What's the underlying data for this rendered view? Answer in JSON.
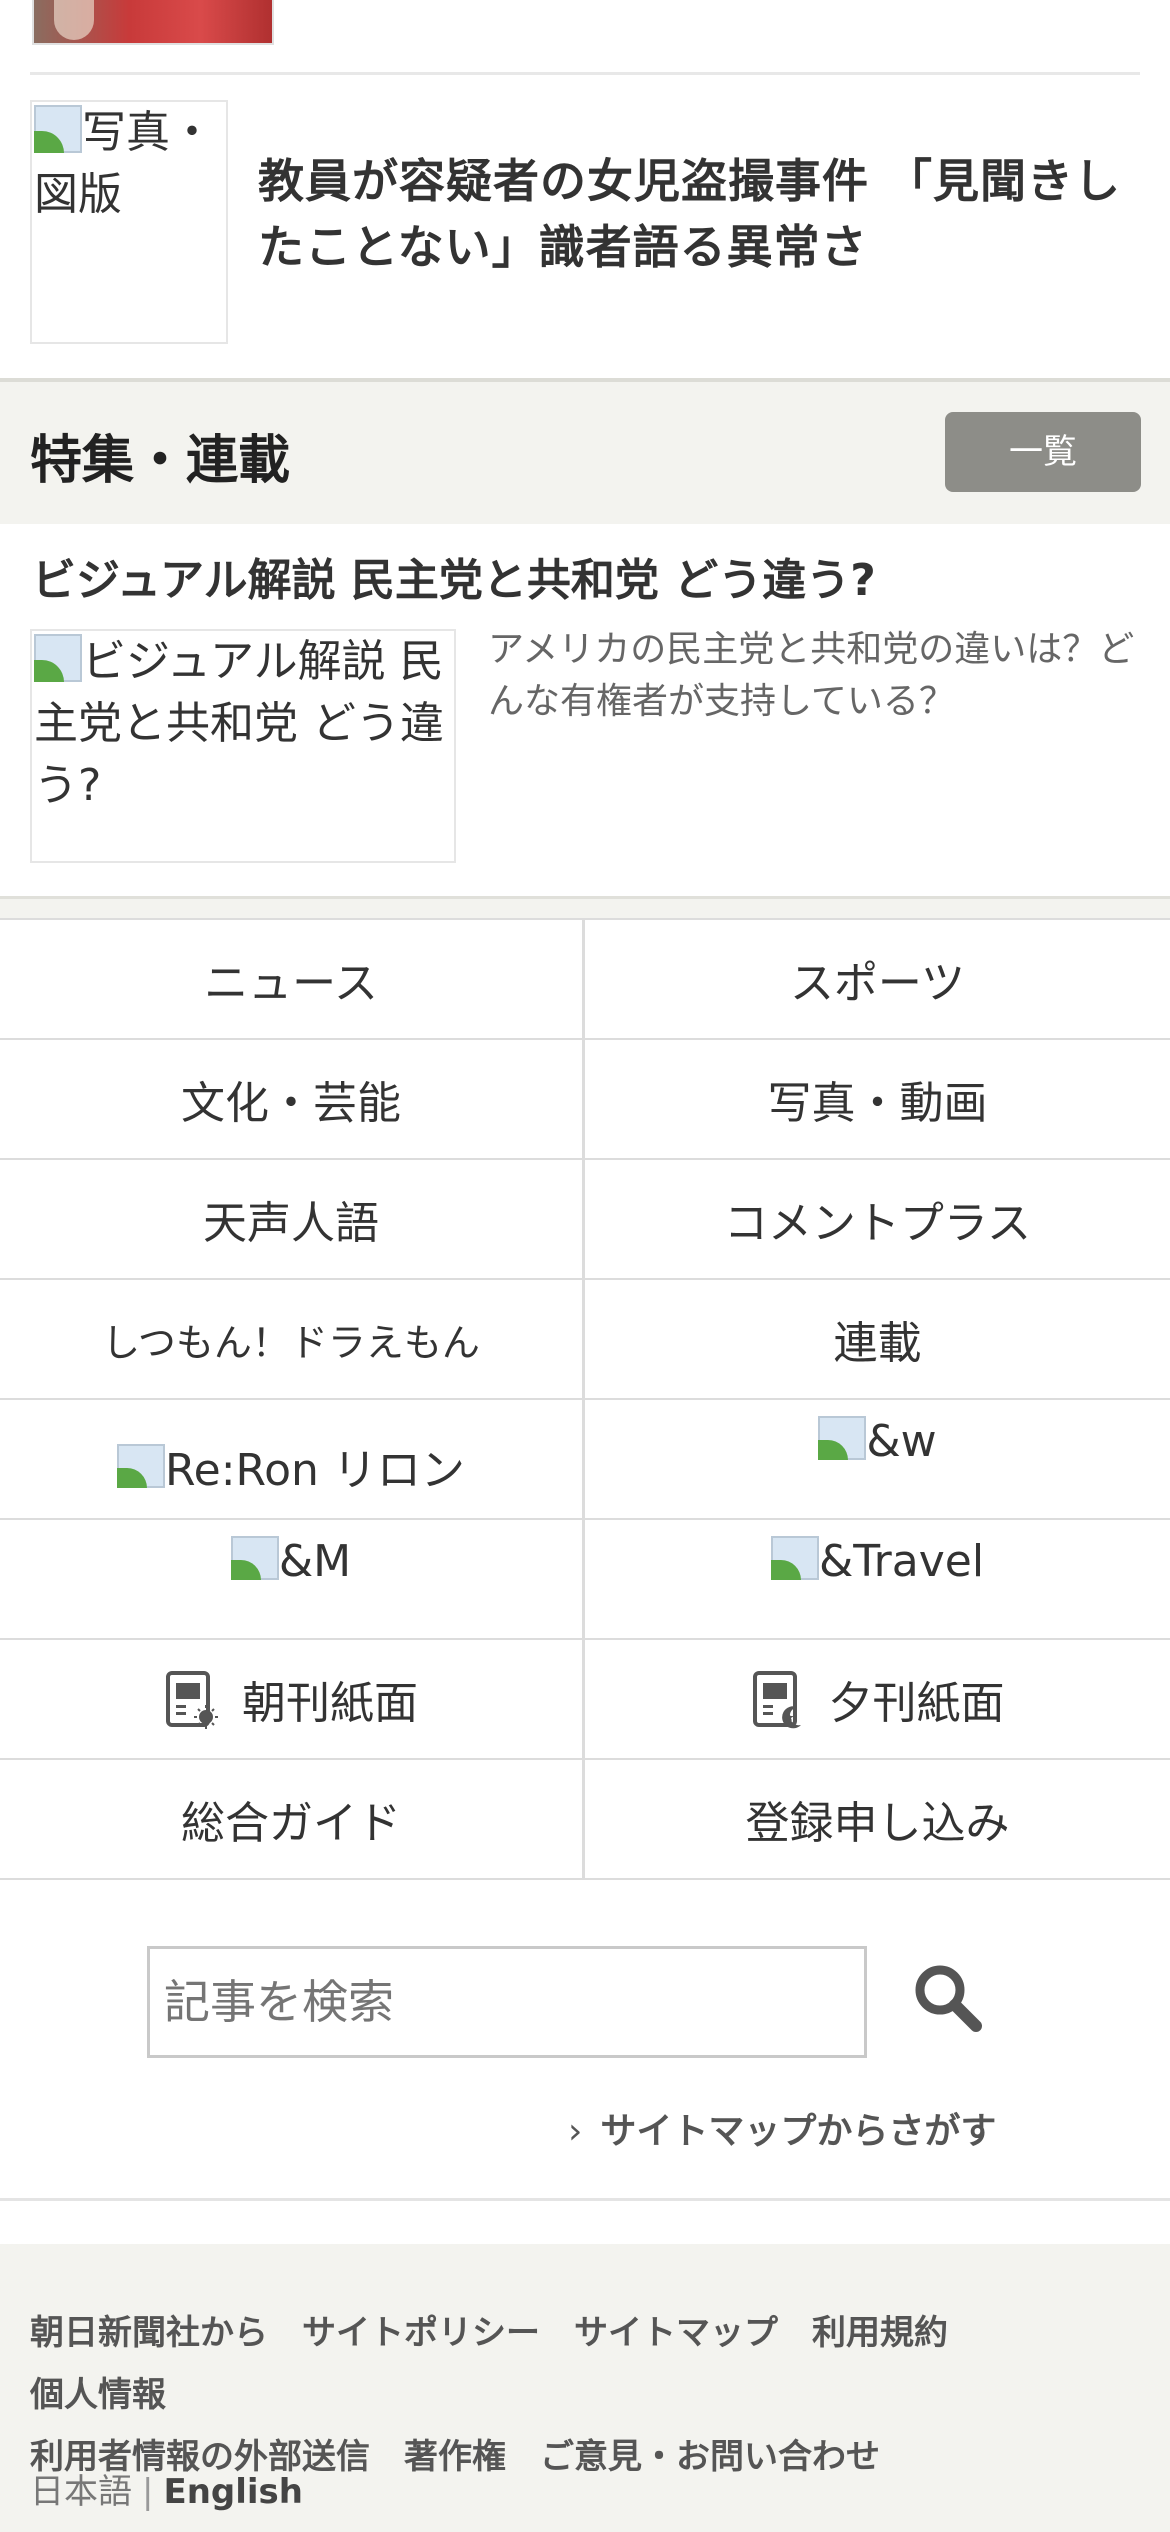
{
  "top_article": {
    "image_alt": "写真・図版",
    "headline": "教員が容疑者の女児盗撮事件 「見聞きしたことない」識者語る異常さ"
  },
  "features": {
    "section_title": "特集・連載",
    "list_button": "一覧",
    "item": {
      "title": "ビジュアル解説 民主党と共和党 どう違う?",
      "image_alt": "ビジュアル解説 民主党と共和党 どう違う?",
      "description": "アメリカの民主党と共和党の違いは？どんな有権者が支持している？"
    }
  },
  "nav": {
    "news": "ニュース",
    "sports": "スポーツ",
    "culture": "文化・芸能",
    "photo_video": "写真・動画",
    "tensei_jingo": "天声人語",
    "comment_plus": "コメントプラス",
    "shitsumon": "しつもん！ドラえもん",
    "rensai": "連載",
    "reron": "Re:Ron リロン",
    "andw": "&w",
    "andm": "&M",
    "andtravel": "&Travel",
    "morning": "朝刊紙面",
    "evening": "夕刊紙面",
    "guide": "総合ガイド",
    "register": "登録申し込み"
  },
  "search": {
    "placeholder": "記事を検索",
    "sitemap_link": "サイトマップからさがす"
  },
  "footer": {
    "links": [
      "朝日新聞社から",
      "サイトポリシー",
      "サイトマップ",
      "利用規約",
      "個人情報",
      "利用者情報の外部送信",
      "著作権",
      "ご意見・お問い合わせ"
    ],
    "lang_ja": "日本語",
    "lang_sep": "|",
    "lang_en": "English"
  },
  "colors": {
    "list_button_bg": "#8d8d88",
    "section_bg": "#f3f3ef",
    "text": "#333333"
  }
}
